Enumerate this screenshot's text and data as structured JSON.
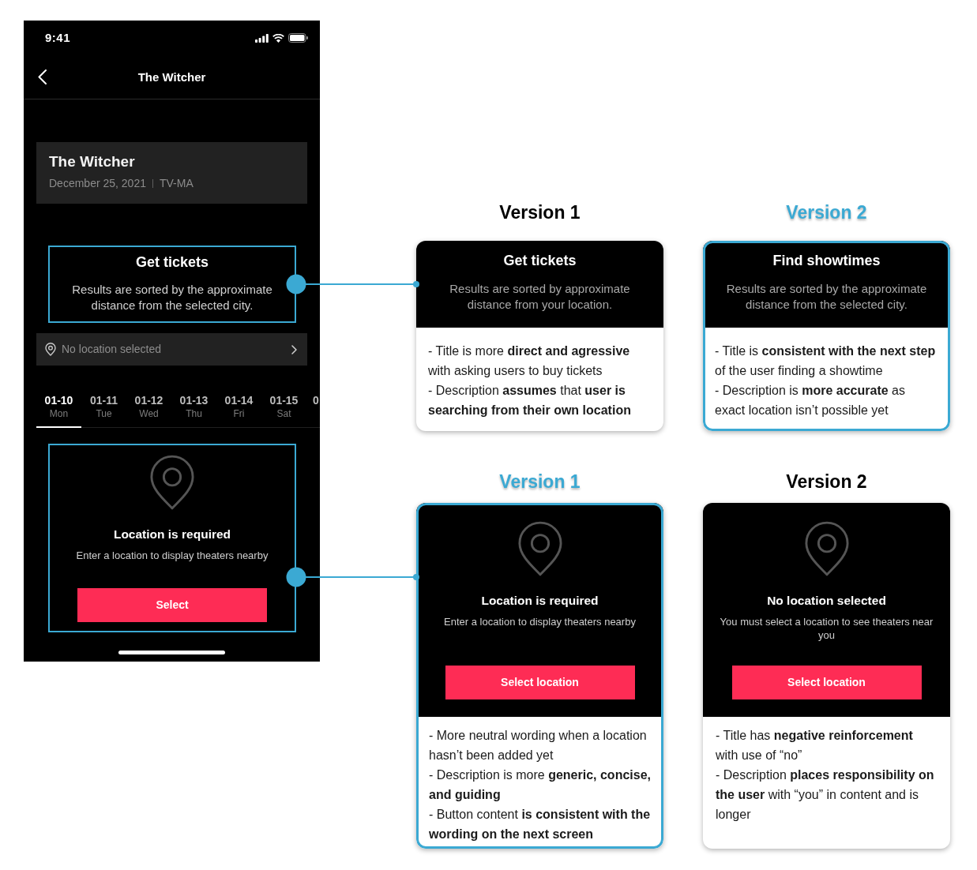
{
  "phone": {
    "status_bar": {
      "time": "9:41"
    },
    "nav_bar": {
      "title": "The Witcher"
    },
    "movie": {
      "title": "The Witcher",
      "date": "December 25, 2021",
      "rating": "TV-MA"
    },
    "header": {
      "title": "Get tickets",
      "description": "Results are sorted by the approximate distance from the selected city.",
      "highlighted": true
    },
    "location_row": {
      "label": "No location selected"
    },
    "dates": [
      {
        "date": "01-10",
        "day": "Mon",
        "selected": true
      },
      {
        "date": "01-11",
        "day": "Tue",
        "selected": false
      },
      {
        "date": "01-12",
        "day": "Wed",
        "selected": false
      },
      {
        "date": "01-13",
        "day": "Thu",
        "selected": false
      },
      {
        "date": "01-14",
        "day": "Fri",
        "selected": false
      },
      {
        "date": "01-15",
        "day": "Sat",
        "selected": false
      },
      {
        "date": "0",
        "selected": false
      }
    ],
    "empty_state": {
      "title": "Location is required",
      "description": "Enter a location to display theaters nearby",
      "button": "Select",
      "highlighted": true
    }
  },
  "comparisons": [
    {
      "kind": "header",
      "versions": [
        {
          "heading": "Version 1",
          "highlighted": false,
          "title": "Get tickets",
          "description": "Results are sorted by approximate distance from your location.",
          "notes": [
            "- Title is more **direct and agressive** with asking users to buy tickets",
            "- Description **assumes** that **user is searching from their own location**"
          ]
        },
        {
          "heading": "Version 2",
          "highlighted": true,
          "title": "Find showtimes",
          "description": "Results are sorted by the approximate distance from the selected city.",
          "notes": [
            "- Title is **consistent with the next step** of the user finding a showtime",
            "- Description is **more accurate** as exact location isn’t possible yet"
          ]
        }
      ]
    },
    {
      "kind": "empty_state",
      "versions": [
        {
          "heading": "Version 1",
          "highlighted": true,
          "title": "Location is required",
          "description": "Enter a location to display theaters nearby",
          "button": "Select location",
          "notes": [
            "- More neutral wording when a location hasn’t been added yet",
            "- Description is more **generic, concise, and guiding**",
            "- Button content **is consistent with the wording on the next screen**"
          ]
        },
        {
          "heading": "Version 2",
          "highlighted": false,
          "title": "No location selected",
          "description": "You must select a location to see theaters near you",
          "button": "Select location",
          "notes": [
            "- Title has **negative reinforcement** with use of “no”",
            "- Description **places responsibility on the user** with “you” in content and is longer"
          ]
        }
      ]
    }
  ]
}
